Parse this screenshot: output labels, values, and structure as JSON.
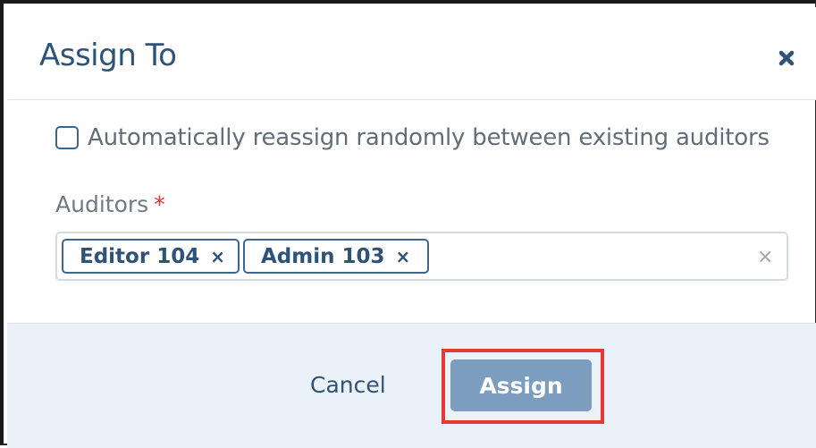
{
  "dialog": {
    "title": "Assign To",
    "close_icon": "close-icon"
  },
  "auto_reassign": {
    "label": "Automatically reassign randomly between existing auditors",
    "checked": false
  },
  "auditors": {
    "label": "Auditors",
    "required_mark": "*",
    "tags": [
      {
        "label": "Editor 104",
        "remove": "×"
      },
      {
        "label": "Admin 103",
        "remove": "×"
      }
    ],
    "clear_all": "×"
  },
  "footer": {
    "cancel_label": "Cancel",
    "assign_label": "Assign"
  },
  "colors": {
    "title": "#2f5279",
    "primary_button": "#7d9dbf",
    "footer_bg": "#eaf1f9",
    "highlight": "#e53935",
    "required": "#e0303a"
  }
}
